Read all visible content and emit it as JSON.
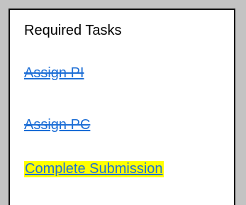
{
  "panel": {
    "title": "Required Tasks",
    "tasks": [
      {
        "label": "Assign PI",
        "completed": true,
        "highlighted": false
      },
      {
        "label": "Assign PC",
        "completed": true,
        "highlighted": false
      },
      {
        "label": "Complete Submission",
        "completed": false,
        "highlighted": true
      }
    ]
  },
  "colors": {
    "background": "#c3c3c3",
    "panel": "#ffffff",
    "link": "#1e6fd6",
    "highlight": "#ffff00"
  }
}
